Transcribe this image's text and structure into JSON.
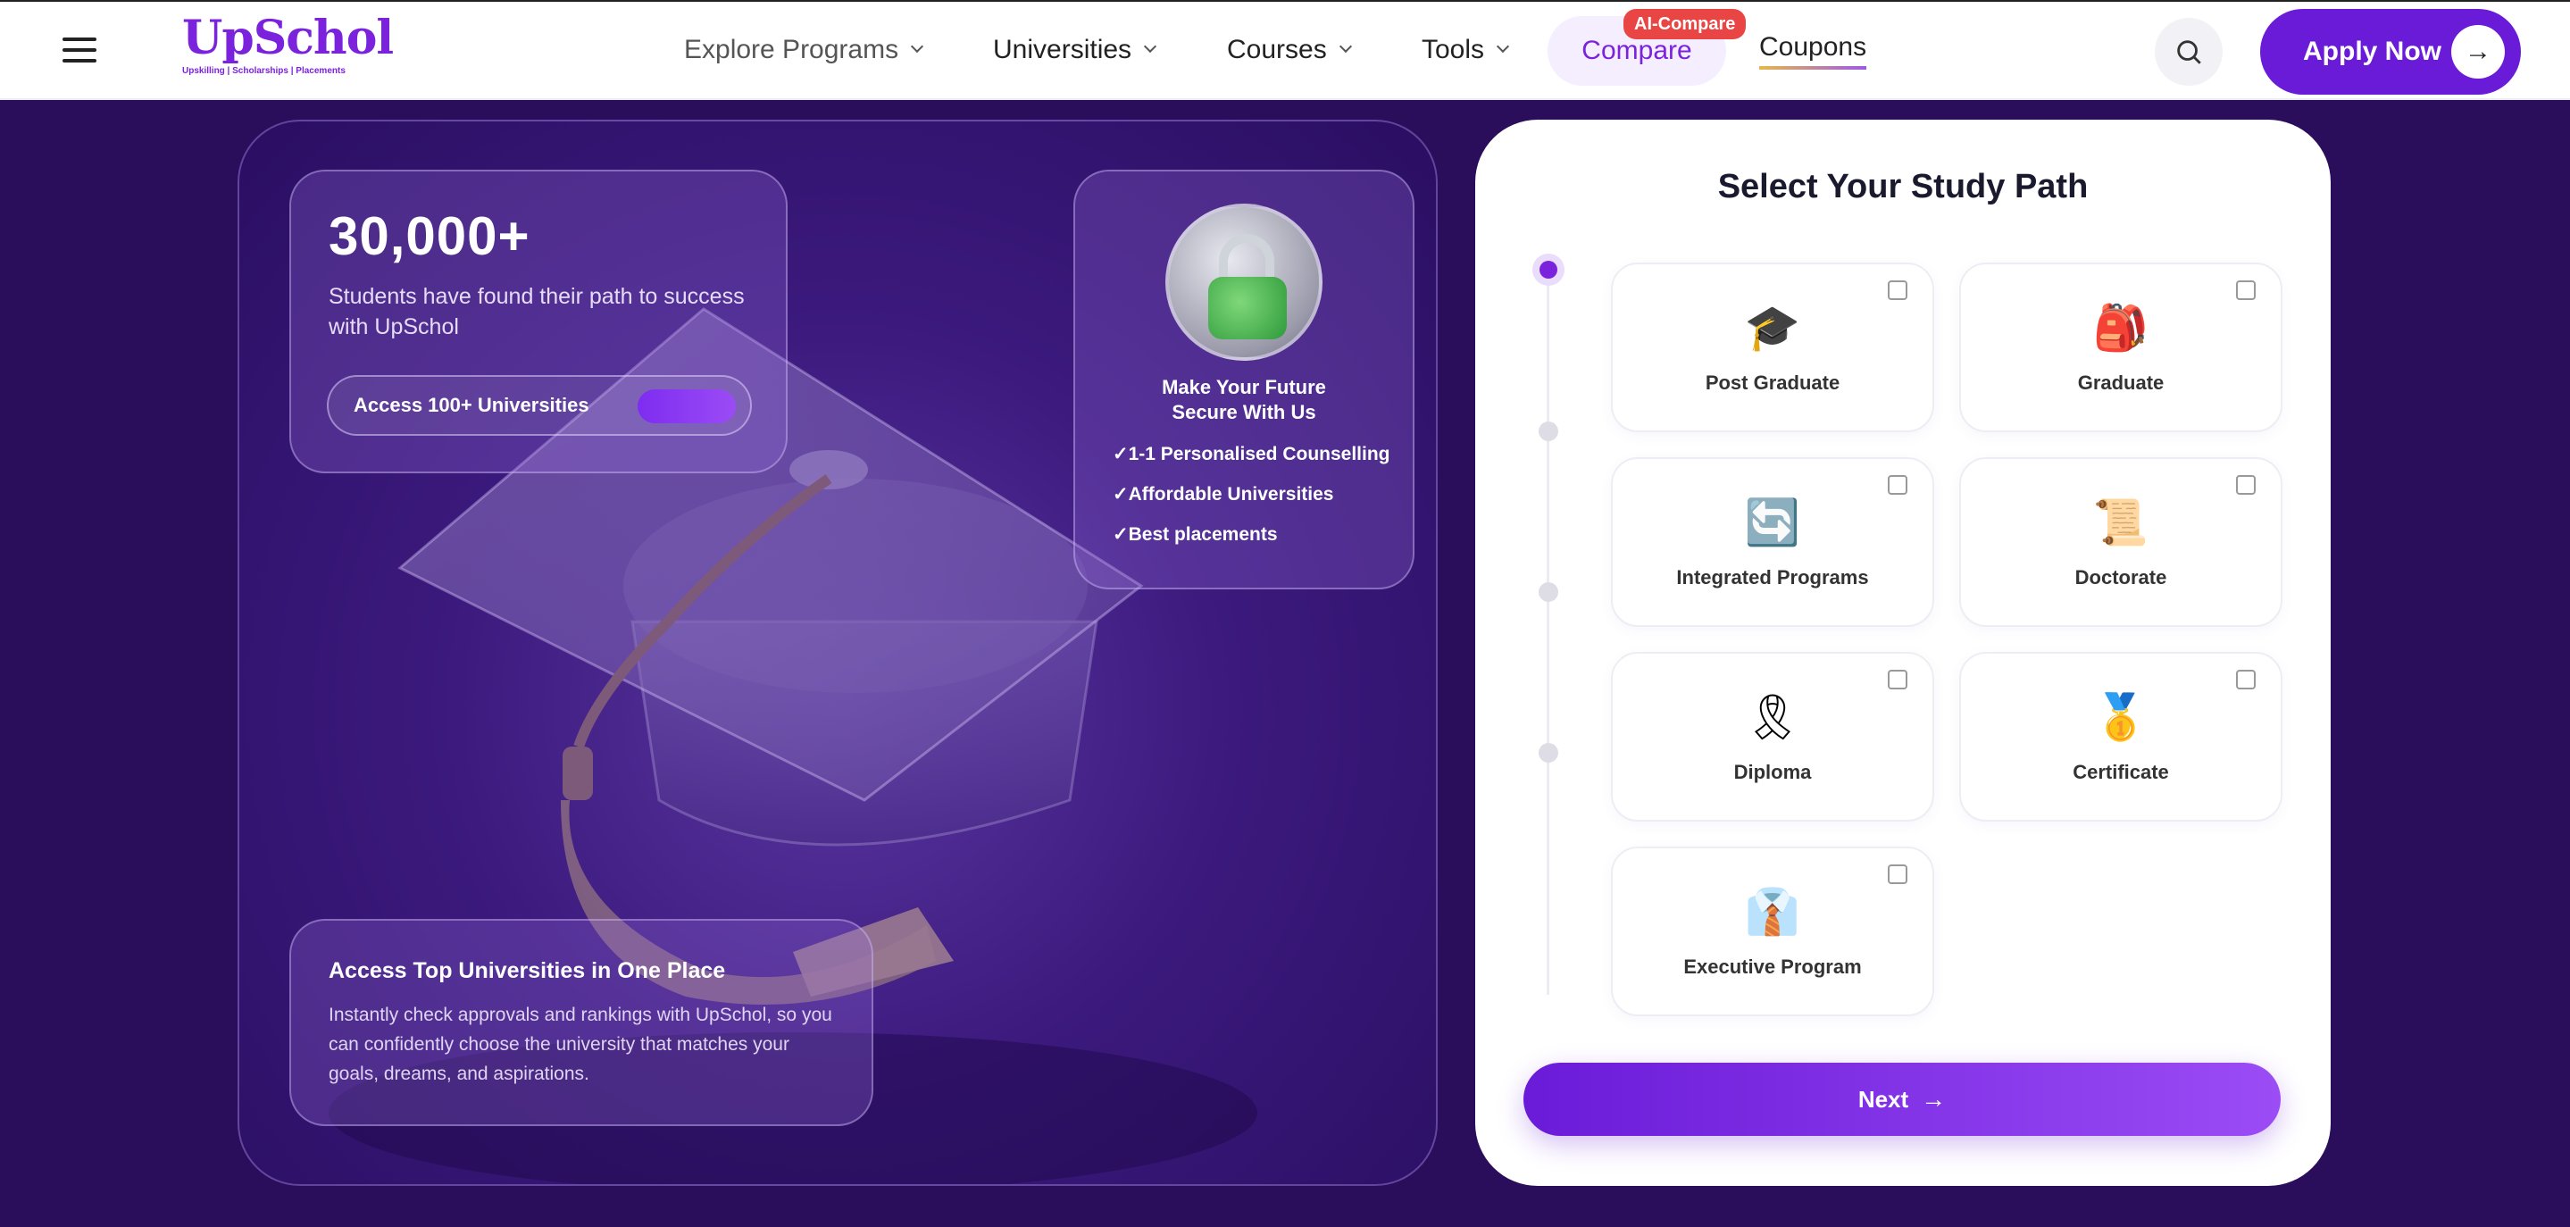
{
  "header": {
    "logo": {
      "word": "UpSchol",
      "tagline": "Upskilling | Scholarships | Placements"
    },
    "nav": [
      {
        "label": "Explore Programs"
      },
      {
        "label": "Universities"
      },
      {
        "label": "Courses"
      },
      {
        "label": "Tools"
      }
    ],
    "compare_label": "Compare",
    "compare_badge": "AI-Compare",
    "coupons_label": "Coupons",
    "apply_label": "Apply Now",
    "apply_arrow": "→",
    "icons": {
      "menu": "hamburger-icon",
      "search": "search-icon",
      "arrow": "arrow-right-icon"
    },
    "colors": {
      "brand": "#7b22dc",
      "badge": "#e94545"
    }
  },
  "hero": {
    "stat_value": "30,000+",
    "stat_text": "Students have found their path to success with UpSchol",
    "access_pill": "Access 100+ Universities",
    "secure_title": "Make Your Future\nSecure With Us",
    "secure_points": [
      "✓1-1 Personalised Counselling",
      "✓Affordable Universities",
      "✓Best placements"
    ],
    "univ_title": "Access Top Universities in One Place",
    "univ_text": "Instantly check approvals and rankings with UpSchol, so you can confidently choose the university that matches your goals, dreams, and aspirations."
  },
  "form": {
    "title": "Select Your Study Path",
    "options": [
      {
        "label": "Post Graduate",
        "icon": "🎓",
        "icon_name": "graduation-cap-icon",
        "checked": false
      },
      {
        "label": "Graduate",
        "icon": "🎒",
        "icon_name": "backpack-icon",
        "checked": false
      },
      {
        "label": "Integrated Programs",
        "icon": "🔄",
        "icon_name": "cycle-arrows-icon",
        "checked": false
      },
      {
        "label": "Doctorate",
        "icon": "📜",
        "icon_name": "scroll-icon",
        "checked": false
      },
      {
        "label": "Diploma",
        "icon": "🎗",
        "icon_name": "ribbon-icon",
        "checked": false
      },
      {
        "label": "Certificate",
        "icon": "🥇",
        "icon_name": "medal-icon",
        "checked": false
      },
      {
        "label": "Executive Program",
        "icon": "👔",
        "icon_name": "necktie-icon",
        "checked": false
      }
    ],
    "steps_total": 4,
    "active_step": 1,
    "next_label": "Next",
    "next_arrow": "→"
  }
}
